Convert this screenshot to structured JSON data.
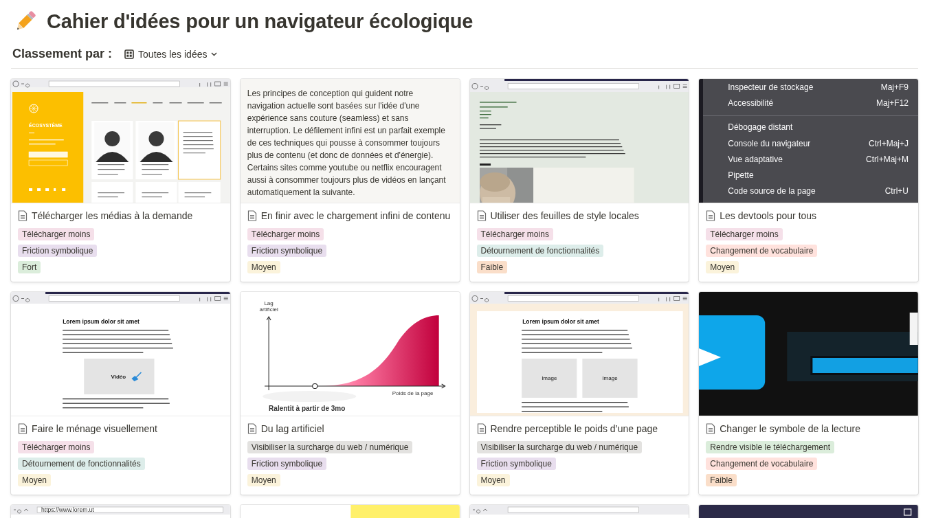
{
  "page": {
    "title": "Cahier d'idées pour un navigateur écologique"
  },
  "sort": {
    "label": "Classement par :",
    "view": "Toutes les idées"
  },
  "cards": [
    {
      "title": "Télécharger les médias à la demande",
      "preview": {
        "kind": "website",
        "heading": "ÉCOSYSTÈME"
      },
      "tags": [
        {
          "label": "Télécharger moins",
          "color": "#f5e0e9"
        },
        {
          "label": "Friction symbolique",
          "color": "#e8deee"
        },
        {
          "label": "Fort",
          "color": "#dbeddb"
        }
      ]
    },
    {
      "title": "En finir avec le chargement infini de contenu",
      "preview": {
        "kind": "text",
        "text": "Les principes de conception qui guident notre navigation actuelle sont basées sur l'idée d'une expérience sans couture (seamless) et sans interruption. Le défilement infini est un parfait exemple de ces techniques qui pousse à consommer toujours plus de contenu (et donc de données et d'énergie). Certains sites comme youtube ou netflix encouragent aussi à consommer toujours plus de vidéos en lançant automatiquement la suivante."
      },
      "tags": [
        {
          "label": "Télécharger moins",
          "color": "#f5e0e9"
        },
        {
          "label": "Friction symbolique",
          "color": "#e8deee"
        },
        {
          "label": "Moyen",
          "color": "#fbf3db"
        }
      ]
    },
    {
      "title": "Utiliser des feuilles de style locales",
      "preview": {
        "kind": "portfolio"
      },
      "tags": [
        {
          "label": "Télécharger moins",
          "color": "#f5e0e9"
        },
        {
          "label": "Détournement de fonctionnalités",
          "color": "#ddedea"
        },
        {
          "label": "Faible",
          "color": "#fadec9"
        }
      ]
    },
    {
      "title": "Les devtools pour tous",
      "preview": {
        "kind": "menu",
        "items": [
          {
            "kind": "entry",
            "label": "Inspecteur de stockage",
            "shortcut": "Maj+F9"
          },
          {
            "kind": "entry",
            "label": "Accessibilité",
            "shortcut": "Maj+F12"
          },
          {
            "kind": "separator"
          },
          {
            "kind": "entry",
            "label": "Débogage distant"
          },
          {
            "kind": "entry",
            "label": "Console du navigateur",
            "shortcut": "Ctrl+Maj+J"
          },
          {
            "kind": "entry",
            "label": "Vue adaptative",
            "shortcut": "Ctrl+Maj+M"
          },
          {
            "kind": "entry",
            "label": "Pipette"
          },
          {
            "kind": "entry",
            "label": "Code source de la page",
            "shortcut": "Ctrl+U"
          }
        ]
      },
      "tags": [
        {
          "label": "Télécharger moins",
          "color": "#f5e0e9"
        },
        {
          "label": "Changement de vocabulaire",
          "color": "#ffe2dd"
        },
        {
          "label": "Moyen",
          "color": "#fbf3db"
        }
      ]
    },
    {
      "title": "Faire le ménage visuellement",
      "preview": {
        "kind": "article",
        "framed": false,
        "heading": "Lorem ipsum dolor sit amet",
        "media": [
          {
            "kind": "video",
            "label": "Vidéo"
          }
        ]
      },
      "tags": [
        {
          "label": "Télécharger moins",
          "color": "#f5e0e9"
        },
        {
          "label": "Détournement de fonctionnalités",
          "color": "#ddedea"
        },
        {
          "label": "Moyen",
          "color": "#fbf3db"
        }
      ]
    },
    {
      "title": "Du lag artificiel",
      "preview": {
        "kind": "diagram",
        "y_label": "Lag artificiel",
        "x_label": "Poids de la page",
        "caption": "Ralentit à partir de 3mo"
      },
      "tags": [
        {
          "label": "Visibiliser la surcharge du web / numérique",
          "color": "#e3e2e0"
        },
        {
          "label": "Friction symbolique",
          "color": "#e8deee"
        },
        {
          "label": "Moyen",
          "color": "#fbf3db"
        }
      ]
    },
    {
      "title": "Rendre perceptible le poids d’une page",
      "preview": {
        "kind": "article",
        "framed": true,
        "heading": "Lorem ipsum dolor sit amet",
        "media": [
          {
            "label": "Image"
          },
          {
            "label": "Image"
          }
        ]
      },
      "tags": [
        {
          "label": "Visibiliser la surcharge du web / numérique",
          "color": "#e3e2e0"
        },
        {
          "label": "Friction symbolique",
          "color": "#e8deee"
        },
        {
          "label": "Moyen",
          "color": "#fbf3db"
        }
      ]
    },
    {
      "title": "Changer le symbole de la lecture",
      "preview": {
        "kind": "player"
      },
      "tags": [
        {
          "label": "Rendre visible le téléchargement",
          "color": "#dbeddb"
        },
        {
          "label": "Changement de vocabulaire",
          "color": "#ffe2dd"
        },
        {
          "label": "Faible",
          "color": "#fadec9"
        }
      ]
    },
    {
      "preview": {
        "kind": "browser",
        "url": "https://www.lorem.ut"
      }
    },
    {
      "preview": {
        "kind": "note"
      }
    },
    {
      "preview": {
        "kind": "browser"
      }
    },
    {
      "preview": {
        "kind": "dark"
      }
    }
  ]
}
